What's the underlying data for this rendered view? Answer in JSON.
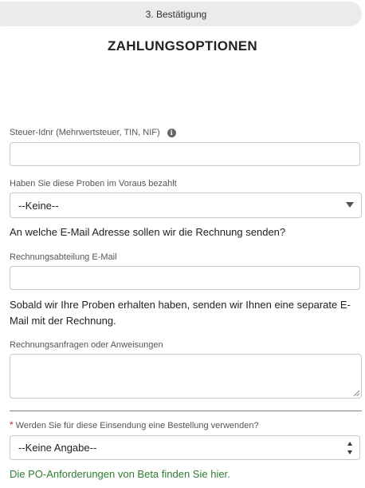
{
  "step_tab": {
    "label": "3. Bestätigung"
  },
  "page_title": "ZAHLUNGSOPTIONEN",
  "tax_id": {
    "label": "Steuer-Idnr (Mehrwertsteuer, TIN, NIF)",
    "value": "",
    "info_icon": "info-icon"
  },
  "prepaid": {
    "label": "Haben Sie diese Proben im Voraus bezahlt",
    "selected": "--Keine--"
  },
  "invoice_email_question": "An welche E-Mail Adresse sollen wir die Rechnung senden?",
  "billing_email": {
    "label": "Rechnungsabteilung E-Mail",
    "value": ""
  },
  "invoice_note": "Sobald wir Ihre Proben erhalten haben, senden wir Ihnen eine separate E-Mail mit der Rechnung.",
  "billing_requests": {
    "label": "Rechnungsanfragen oder Anweisungen",
    "value": ""
  },
  "purchase_order": {
    "required_marker": "*",
    "label": "Werden Sie für diese Einsendung eine Bestellung verwenden?",
    "selected": "--Keine Angabe--"
  },
  "po_link": "Die PO-Anforderungen von Beta finden Sie hier.",
  "colors": {
    "required": "#c0262d",
    "link": "#2e7d32",
    "tab_bg": "#ebebeb"
  }
}
